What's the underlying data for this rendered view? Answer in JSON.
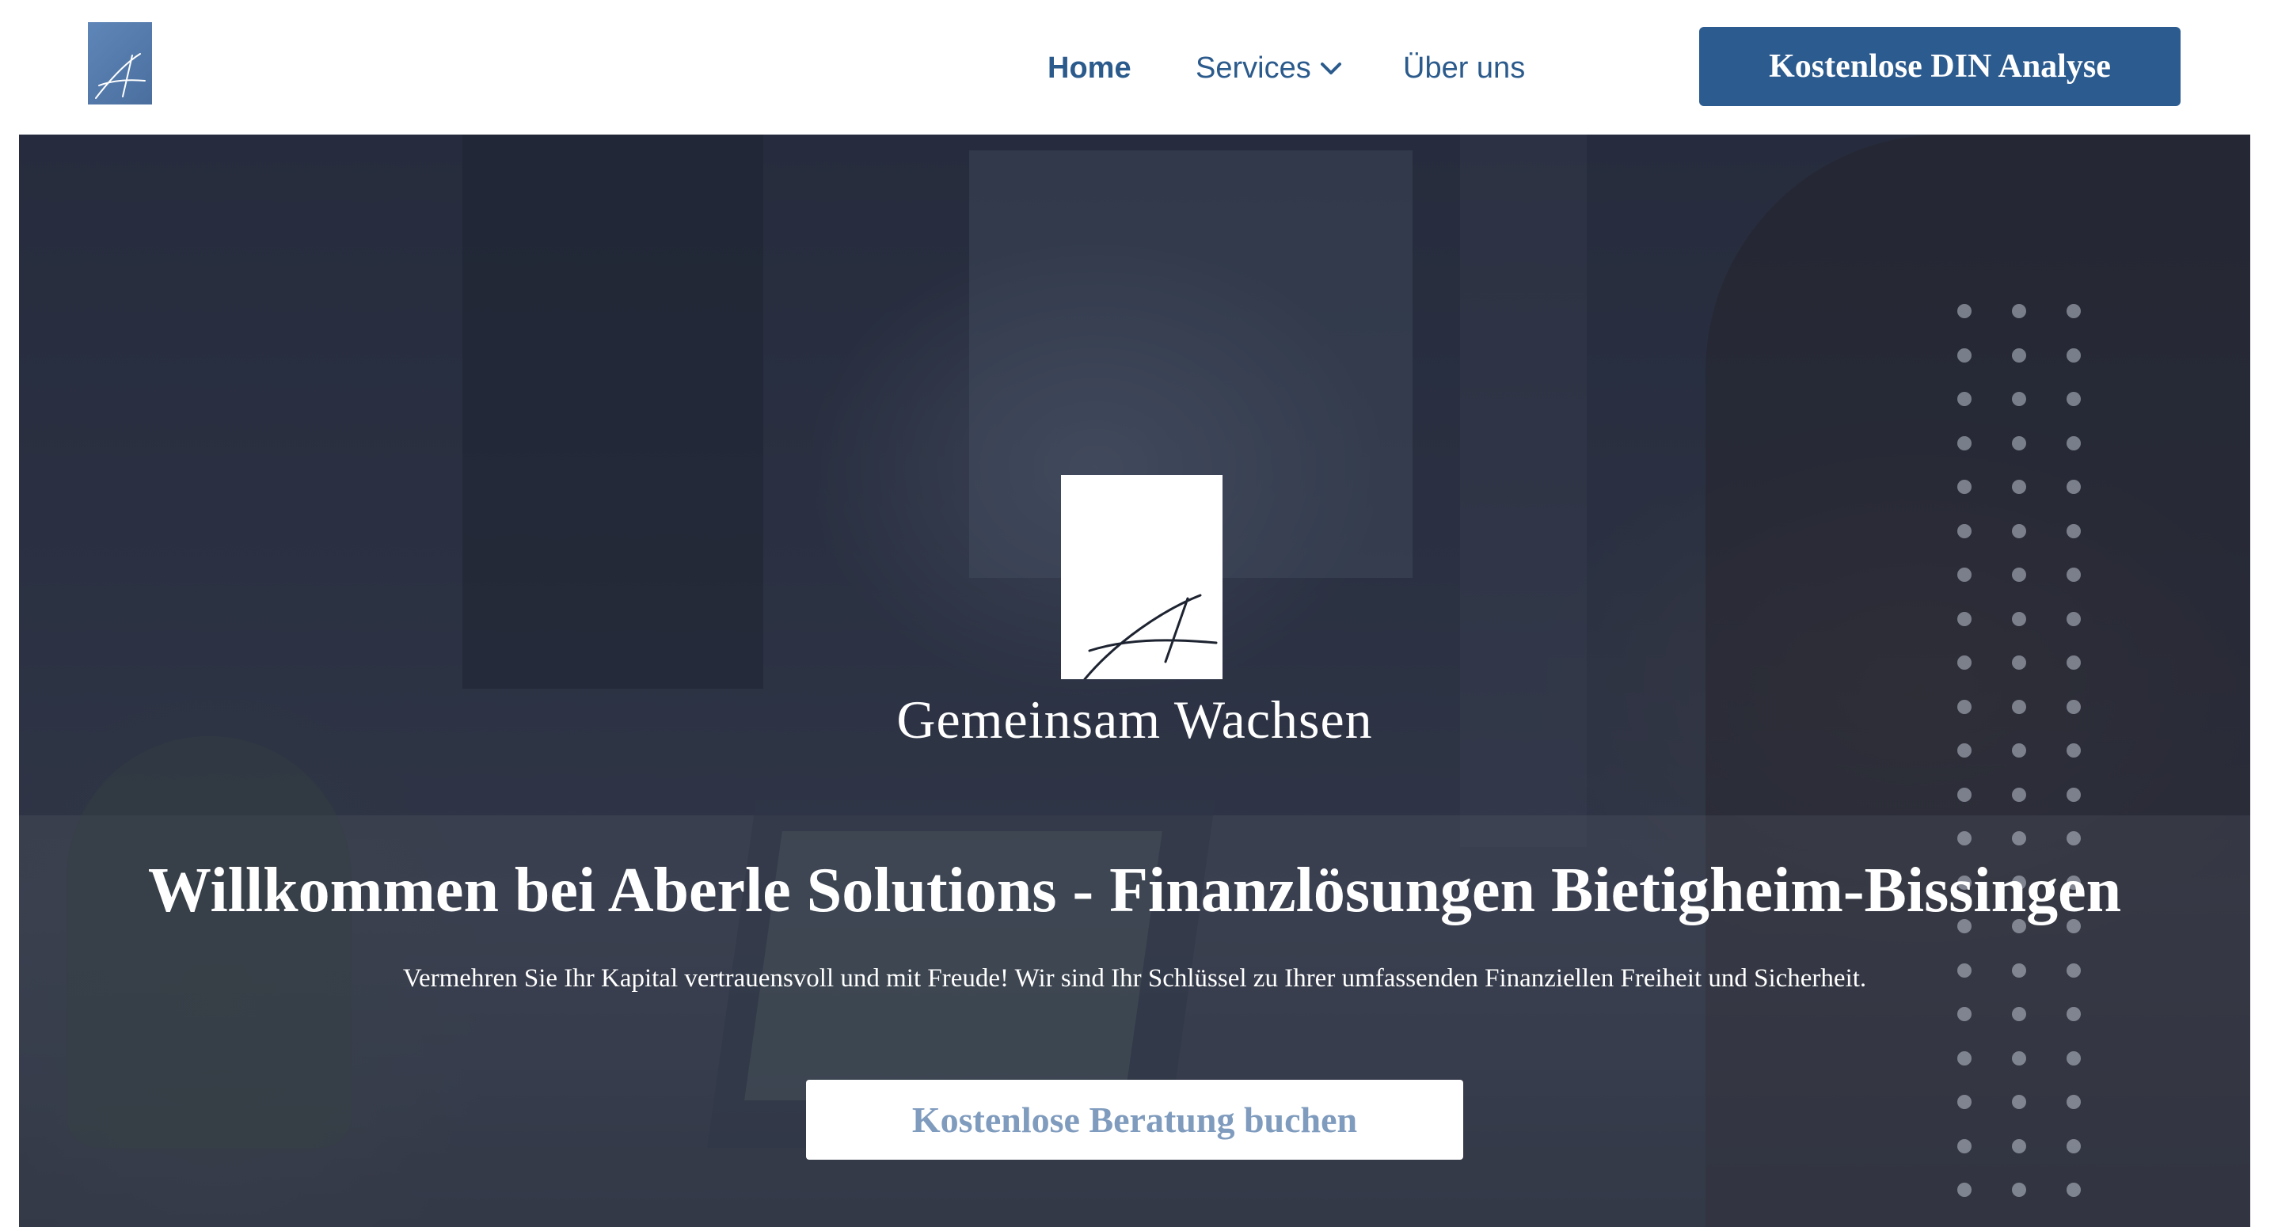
{
  "header": {
    "logo_alt": "A",
    "nav": {
      "home_label": "Home",
      "services_label": "Services",
      "about_label": "Über uns"
    },
    "cta_label": "Kostenlose DIN Analyse"
  },
  "hero": {
    "logo_letter": "A",
    "tagline": "Gemeinsam Wachsen",
    "headline": "Willkommen bei Aberle Solutions - Finanzlösungen Bietigheim-Bissingen",
    "subline": "Vermehren Sie Ihr Kapital vertrauensvoll und mit Freude! Wir sind Ihr Schlüssel zu Ihrer umfassenden Finanziellen Freiheit und Sicherheit.",
    "cta_label": "Kostenlose Beratung buchen"
  },
  "colors": {
    "brand": "#2c5b8f",
    "nav_text": "#2b5a8c",
    "cta_hero_text": "#7f9bbd",
    "logo_bg": "#5f86b8"
  },
  "icons": {
    "services_dropdown": "chevron-down-icon"
  }
}
